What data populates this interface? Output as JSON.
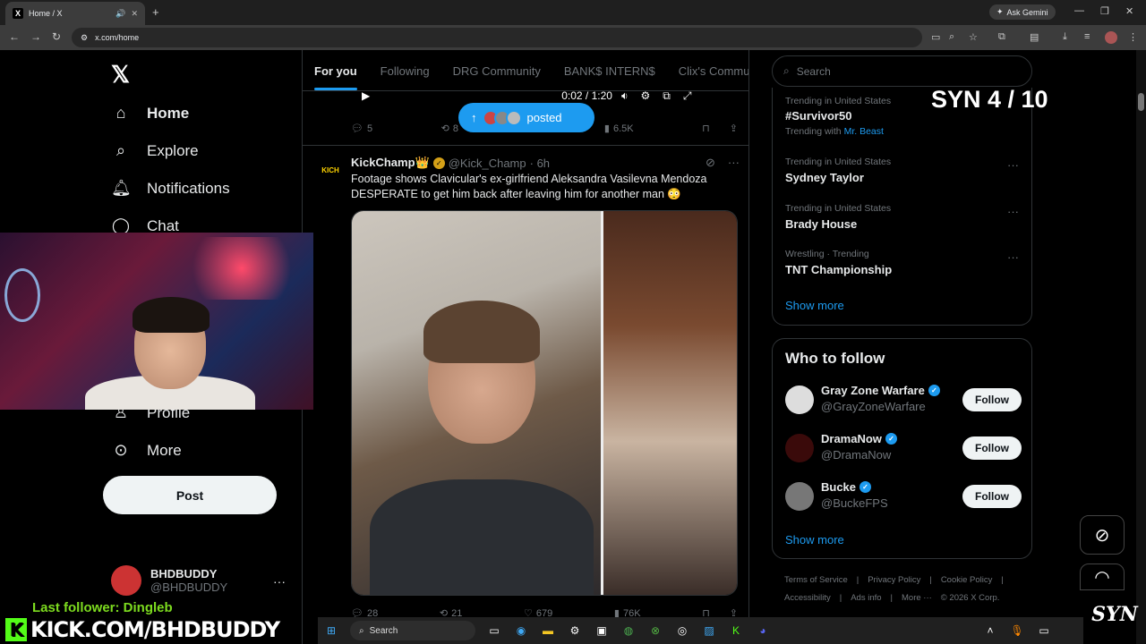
{
  "browser": {
    "tab_title": "Home / X",
    "new_tab": "+",
    "ask_gemini": "Ask Gemini",
    "url": "x.com/home"
  },
  "sidebar": {
    "items": [
      {
        "label": "Home",
        "icon": "home-icon"
      },
      {
        "label": "Explore",
        "icon": "search-icon"
      },
      {
        "label": "Notifications",
        "icon": "bell-icon"
      },
      {
        "label": "Chat",
        "icon": "chat-icon"
      },
      {
        "label": "Profile",
        "icon": "person-icon"
      },
      {
        "label": "More",
        "icon": "more-circle-icon"
      }
    ],
    "post_label": "Post",
    "account": {
      "name": "BHDBUDDY",
      "handle": "@BHDBUDDY"
    }
  },
  "feed": {
    "tabs": [
      "For you",
      "Following",
      "DRG Community",
      "BANK$ INTERN$",
      "Clix's Commu"
    ],
    "video_time": "0:02 / 1:20",
    "posted_pill": "posted",
    "prev_actions": {
      "replies": "5",
      "reposts": "8",
      "views": "6.5K"
    },
    "tweet": {
      "avatar_text": "KICH",
      "name": "KickChamp👑",
      "handle": "@Kick_Champ",
      "time": "· 6h",
      "text": "Footage shows Clavicular's ex-girlfriend Aleksandra Vasilevna Mendoza DESPERATE to get him back after leaving him for another man 😳",
      "actions": {
        "replies": "28",
        "reposts": "21",
        "likes": "679",
        "views": "76K"
      }
    }
  },
  "right": {
    "search_placeholder": "Search",
    "trends": [
      {
        "context": "Trending in United States",
        "title": "#Survivor50",
        "with_label": "Trending with",
        "with_link": "Mr. Beast"
      },
      {
        "context": "Trending in United States",
        "title": "Sydney Taylor"
      },
      {
        "context": "Trending in United States",
        "title": "Brady House"
      },
      {
        "context": "Wrestling · Trending",
        "title": "TNT Championship"
      }
    ],
    "show_more": "Show more",
    "who_to_follow": "Who to follow",
    "follow_suggestions": [
      {
        "name": "Gray Zone Warfare",
        "handle": "@GrayZoneWarfare",
        "button": "Follow"
      },
      {
        "name": "DramaNow",
        "handle": "@DramaNow",
        "button": "Follow"
      },
      {
        "name": "Bucke",
        "handle": "@BuckeFPS",
        "button": "Follow"
      }
    ],
    "footer": [
      "Terms of Service",
      "|",
      "Privacy Policy",
      "|",
      "Cookie Policy",
      "|"
    ],
    "footer2": [
      "Accessibility",
      "|",
      "Ads info",
      "|",
      "More ···",
      "© 2026 X Corp."
    ]
  },
  "overlay": {
    "syn_counter": "SYN 4 / 10",
    "last_follower": "Last follower: Dingleb",
    "kick_url": "KICK.COM/BHDBUDDY",
    "kick_logo": "K",
    "syn_logo": "SYN"
  },
  "taskbar": {
    "search": "Search"
  },
  "colors": {
    "accent": "#1d9bf0",
    "kick_green": "#53fc18",
    "background": "#000000"
  }
}
